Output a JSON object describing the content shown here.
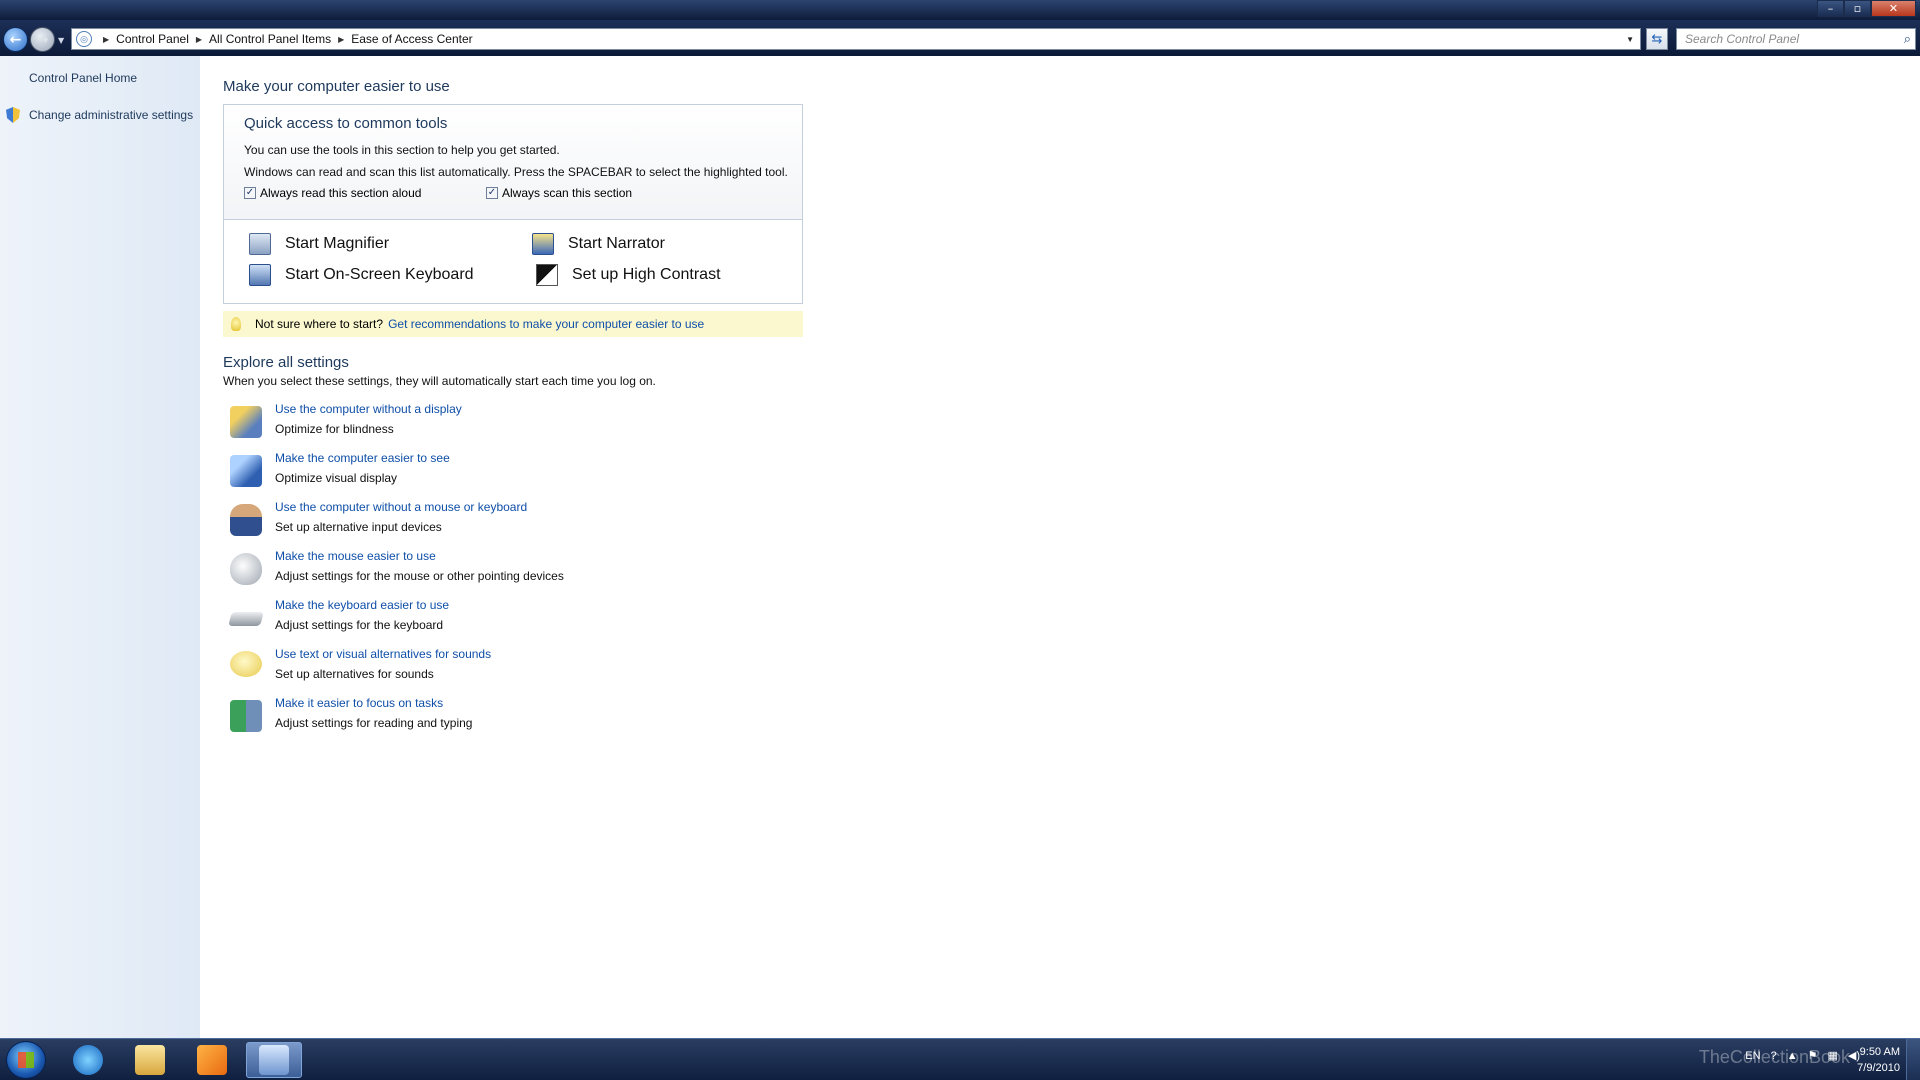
{
  "window": {
    "minimize_label": "–",
    "maximize_label": "▫",
    "close_label": "✕"
  },
  "address": {
    "crumbs": [
      "Control Panel",
      "All Control Panel Items",
      "Ease of Access Center"
    ],
    "search_placeholder": "Search Control Panel"
  },
  "sidebar": {
    "home_label": "Control Panel Home",
    "admin_label": "Change administrative settings"
  },
  "main": {
    "page_title": "Make your computer easier to use",
    "quick": {
      "title": "Quick access to common tools",
      "line1": "You can use the tools in this section to help you get started.",
      "line2": "Windows can read and scan this list automatically.  Press the SPACEBAR to select the highlighted tool.",
      "read_aloud_label": "Always read this section aloud",
      "scan_label": "Always scan this section",
      "read_aloud_checked": true,
      "scan_checked": true,
      "tools": {
        "magnifier": "Start Magnifier",
        "narrator": "Start Narrator",
        "keyboard": "Start On-Screen Keyboard",
        "contrast": "Set up High Contrast"
      }
    },
    "tip": {
      "prefix": "Not sure where to start?",
      "link": "Get recommendations to make your computer easier to use"
    },
    "explore": {
      "title": "Explore all settings",
      "subtitle": "When you select these settings, they will automatically start each time you log on.",
      "items": [
        {
          "title": "Use the computer without a display",
          "desc": "Optimize for blindness"
        },
        {
          "title": "Make the computer easier to see",
          "desc": "Optimize visual display"
        },
        {
          "title": "Use the computer without a mouse or keyboard",
          "desc": "Set up alternative input devices"
        },
        {
          "title": "Make the mouse easier to use",
          "desc": "Adjust settings for the mouse or other pointing devices"
        },
        {
          "title": "Make the keyboard easier to use",
          "desc": "Adjust settings for the keyboard"
        },
        {
          "title": "Use text or visual alternatives for sounds",
          "desc": "Set up alternatives for sounds"
        },
        {
          "title": "Make it easier to focus on tasks",
          "desc": "Adjust settings for reading and typing"
        }
      ]
    }
  },
  "taskbar": {
    "language": "EN",
    "time": "9:50 AM",
    "date": "7/9/2010",
    "watermark": "TheCollectionBook"
  },
  "colors": {
    "link": "#0f4fa8",
    "heading": "#1e395b",
    "tip_background": "#fbf8d0",
    "taskbar": "#1a2d52"
  }
}
